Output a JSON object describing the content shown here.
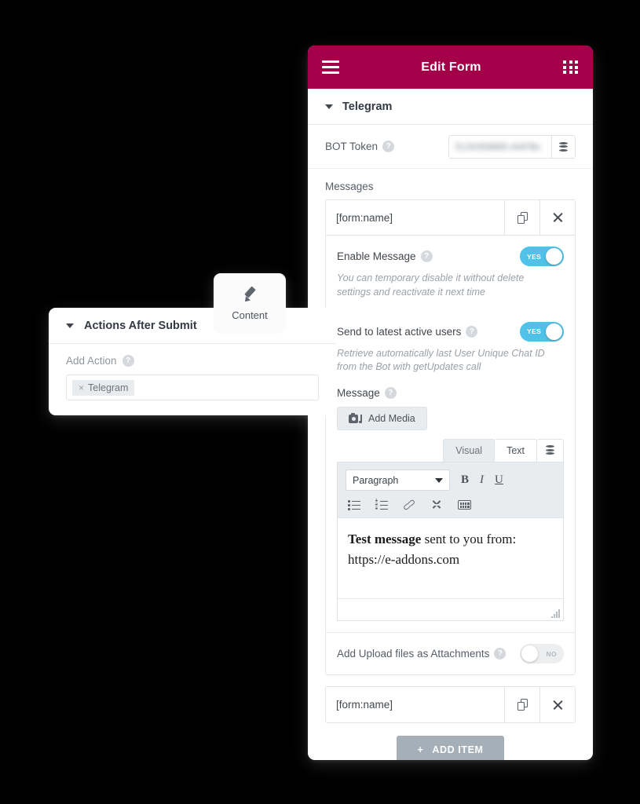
{
  "app": {
    "header": {
      "title": "Edit Form",
      "menu_icon": "hamburger-icon",
      "apps_icon": "grid-icon"
    }
  },
  "telegram_section": {
    "title": "Telegram",
    "collapse_icon": "caret-down-icon",
    "bot_token": {
      "label": "BOT Token",
      "help": "?",
      "value": "5134358885-AAFBs",
      "masked": true,
      "dynamic_icon": "database-icon"
    },
    "messages_label": "Messages",
    "items": [
      {
        "name": "[form:name]",
        "duplicate_icon": "copy-icon",
        "remove_icon": "close-icon",
        "enable_message": {
          "label": "Enable Message",
          "help": "?",
          "state": "YES",
          "on": true,
          "hint": "You can temporary disable it without delete settings and reactivate it next time"
        },
        "send_latest": {
          "label": "Send to latest active users",
          "help": "?",
          "state": "YES",
          "on": true,
          "hint": "Retrieve automatically last User Unique Chat ID from the Bot with getUpdates call"
        },
        "message": {
          "label": "Message",
          "help": "?",
          "add_media_label": "Add Media",
          "add_media_icon": "media-icon",
          "editor": {
            "tabs": [
              {
                "label": "Visual",
                "active": false
              },
              {
                "label": "Text",
                "active": true
              }
            ],
            "dynamic_icon": "database-icon",
            "toolbar": {
              "format_select": "Paragraph",
              "bold": "B",
              "italic": "I",
              "underline": "U",
              "icons": [
                "bulleted-list-icon",
                "numbered-list-icon",
                "link-icon",
                "fullscreen-icon",
                "keyboard-shortcuts-icon"
              ]
            },
            "content_bold": "Test message",
            "content_rest": " sent to you from: https://e-addons.com",
            "resize_handle": "resize-grip-icon"
          }
        },
        "attachments": {
          "label": "Add Upload files as Attachments",
          "help": "?",
          "state": "NO",
          "on": false
        }
      },
      {
        "name": "[form:name]",
        "duplicate_icon": "copy-icon",
        "remove_icon": "close-icon"
      }
    ],
    "add_item_label": "ADD ITEM",
    "add_item_plus": "+"
  },
  "actions_panel": {
    "title": "Actions After Submit",
    "collapse_icon": "caret-down-icon",
    "add_action": {
      "label": "Add Action",
      "help": "?",
      "chips": [
        {
          "remove": "×",
          "label": "Telegram"
        }
      ]
    }
  },
  "content_tab": {
    "label": "Content",
    "icon": "pencil-icon"
  },
  "colors": {
    "header_bg": "#A4004A",
    "toggle_on": "#4FC2E9",
    "toggle_off": "#ECEEF0",
    "add_item_bg": "#A4AFB7",
    "page_bg": "#000000"
  }
}
